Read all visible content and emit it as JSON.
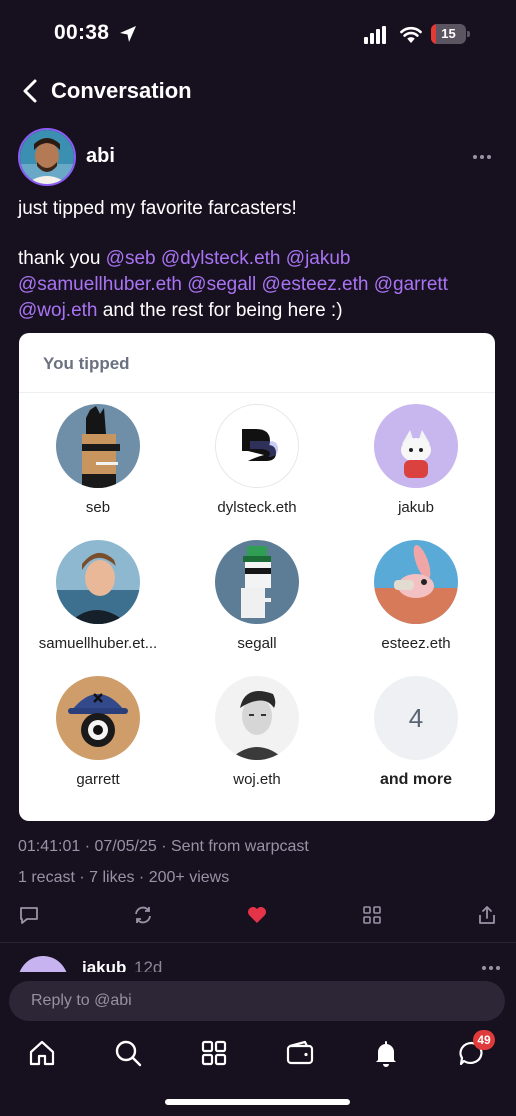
{
  "status_bar": {
    "time": "00:38",
    "battery_level": "15",
    "battery_fraction": 0.15,
    "icons": [
      "location-arrow-icon",
      "signal-icon",
      "wifi-icon",
      "battery-icon"
    ]
  },
  "header": {
    "title": "Conversation",
    "back_icon": "chevron-left-icon"
  },
  "post": {
    "author": "abi",
    "text_line1": "just tipped my favorite farcasters!",
    "text_prefix": "thank you ",
    "mentions": [
      "@seb",
      "@dylsteck.eth",
      "@jakub",
      "@samuellhuber.eth",
      "@segall",
      "@esteez.eth",
      "@garrett",
      "@woj.eth"
    ],
    "text_suffix": " and the rest for being here :)",
    "menu_icon": "more-horizontal-icon"
  },
  "tip_card": {
    "title": "You tipped",
    "recipients": [
      {
        "name": "seb"
      },
      {
        "name": "dylsteck.eth"
      },
      {
        "name": "jakub"
      },
      {
        "name": "samuellhuber.et..."
      },
      {
        "name": "segall"
      },
      {
        "name": "esteez.eth"
      },
      {
        "name": "garrett"
      },
      {
        "name": "woj.eth"
      }
    ],
    "more_count": "4",
    "more_label": "and more"
  },
  "meta": {
    "line1": "01:41:01 · 07/05/25 · Sent from warpcast",
    "line2": "1 recast · 7 likes · 200+ views"
  },
  "actions": [
    "reply-icon",
    "recast-icon",
    "like-icon",
    "grid-icon",
    "share-icon"
  ],
  "colors": {
    "background": "#17101f",
    "mention": "#a974f3",
    "like": "#e5344a",
    "badge": "#e03a3a"
  },
  "next_reply": {
    "author": "jakub",
    "time": "12d"
  },
  "reply_bar": {
    "placeholder": "Reply to @abi"
  },
  "tab_bar": {
    "items": [
      "home-icon",
      "search-icon",
      "apps-icon",
      "wallet-icon",
      "notifications-icon",
      "messages-icon"
    ],
    "messages_badge": "49"
  }
}
